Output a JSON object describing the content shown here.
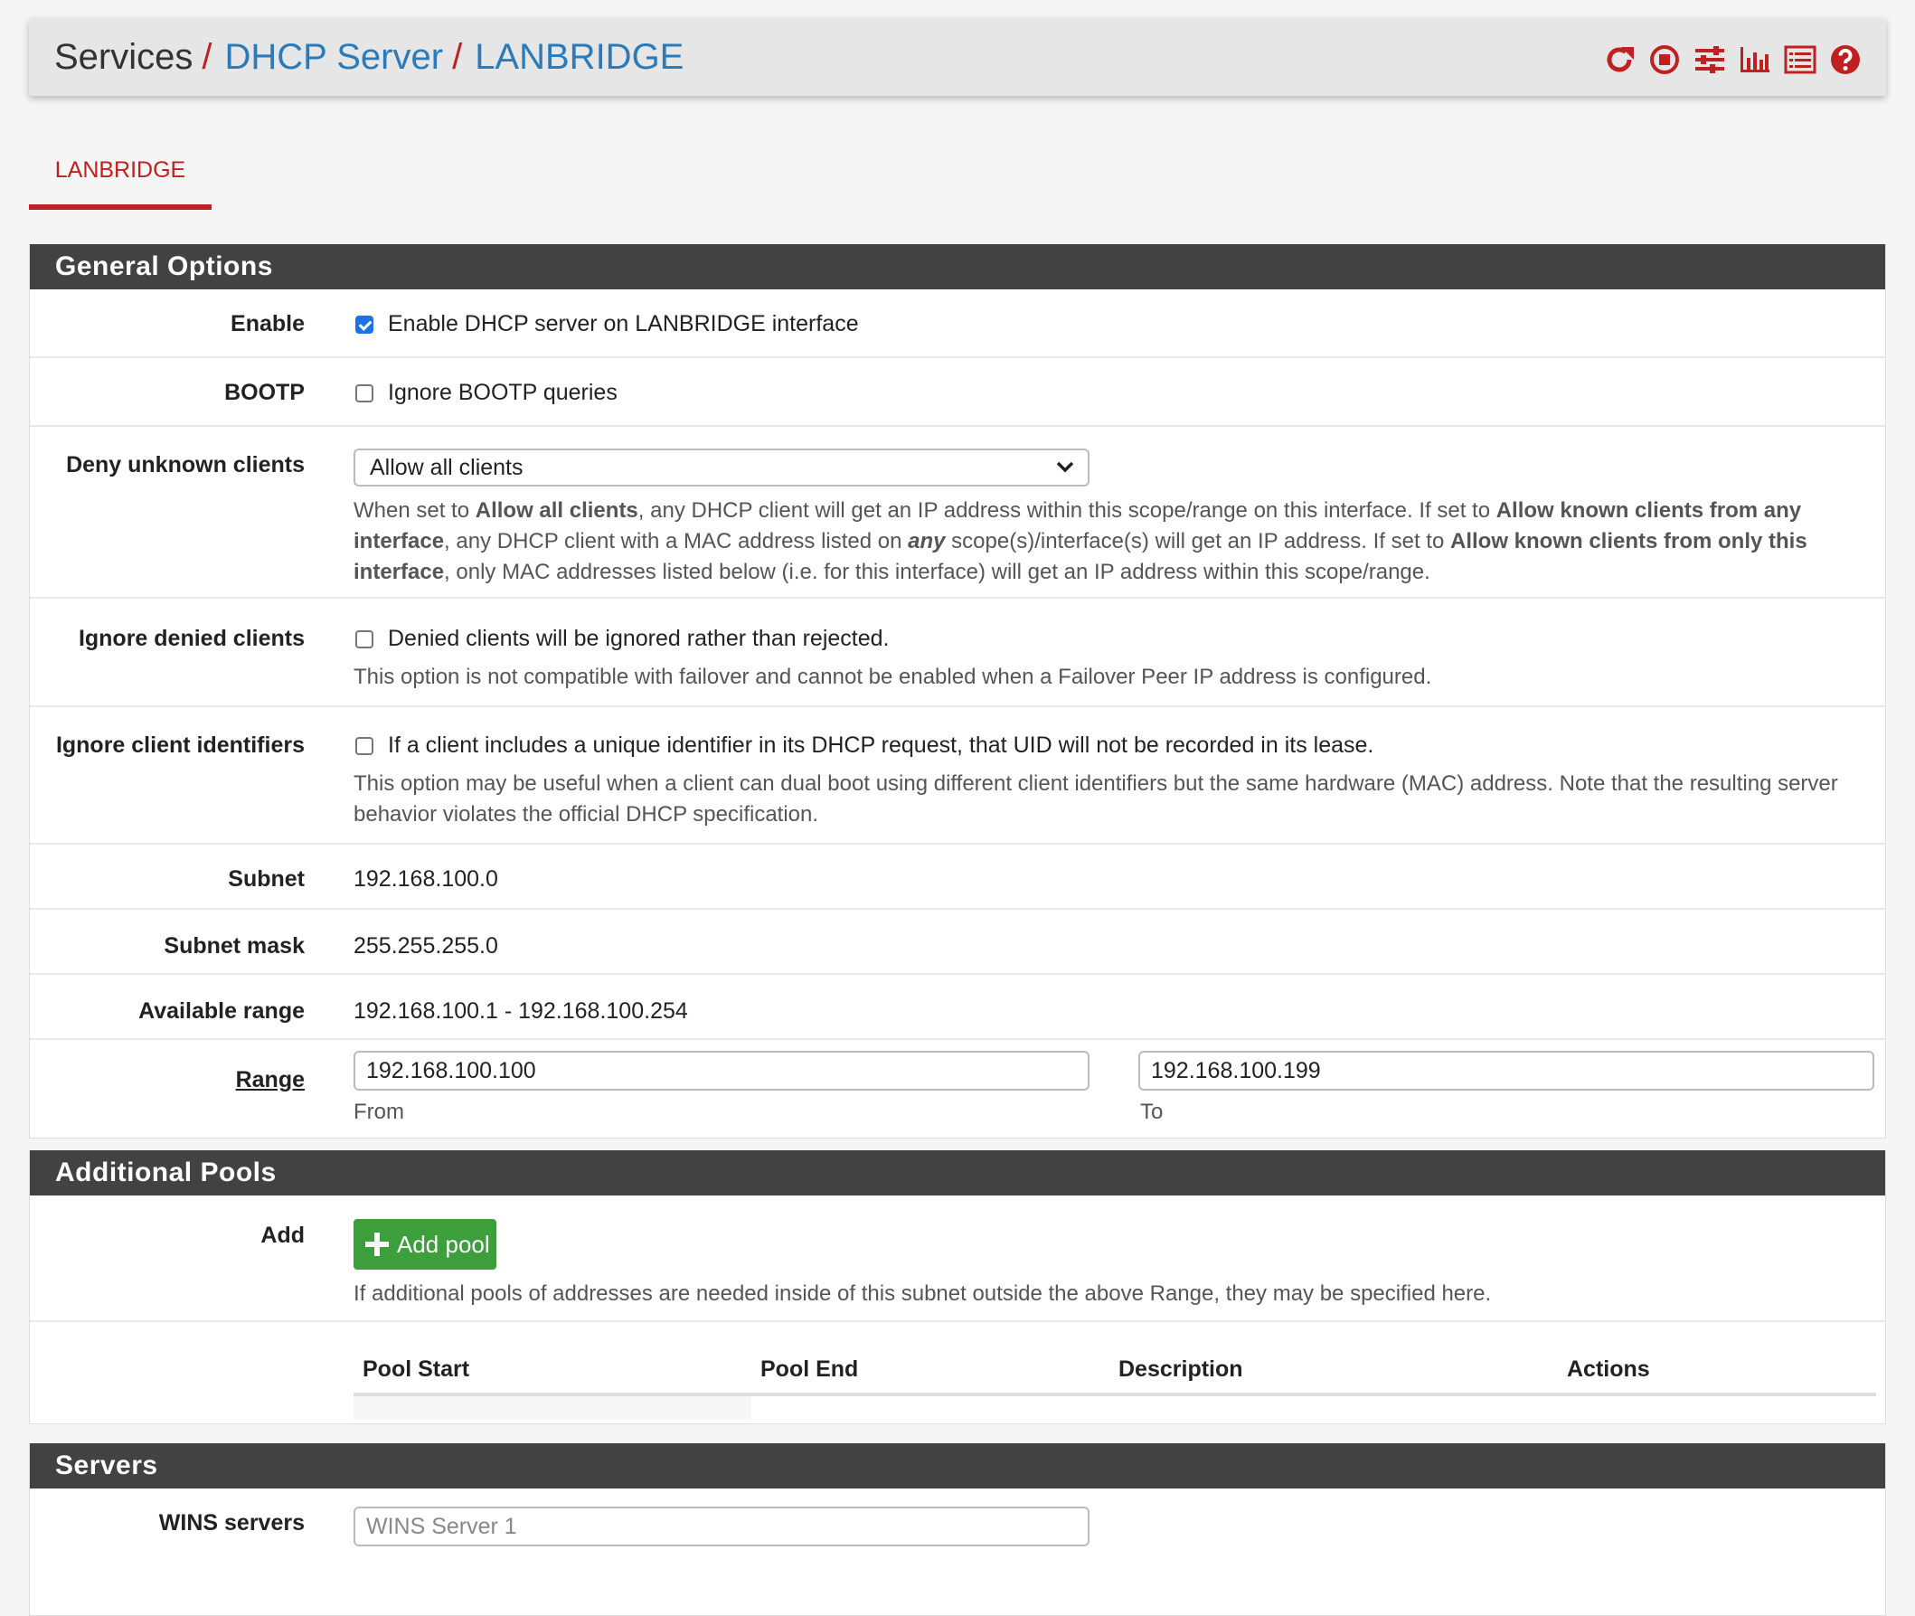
{
  "header": {
    "crumb1": "Services",
    "crumb2": "DHCP Server",
    "crumb3": "LANBRIDGE",
    "separator": "/",
    "icons": [
      "restart-icon",
      "stop-icon",
      "sliders-icon",
      "bar-chart-icon",
      "log-list-icon",
      "help-icon"
    ],
    "accent_color": "#c12020",
    "link_color": "#2b7bba"
  },
  "tabs": [
    {
      "label": "LANBRIDGE",
      "active": true
    }
  ],
  "general": {
    "heading": "General Options",
    "enable": {
      "label": "Enable",
      "text": "Enable DHCP server on LANBRIDGE interface",
      "checked": true
    },
    "bootp": {
      "label": "BOOTP",
      "text": "Ignore BOOTP queries",
      "checked": false
    },
    "deny": {
      "label": "Deny unknown clients",
      "selected": "Allow all clients",
      "h1": "When set to ",
      "h2": "Allow all clients",
      "h3": ", any DHCP client will get an IP address within this scope/range on this interface. If set to ",
      "h4": "Allow known clients from any interface",
      "h5": ", any DHCP client with a MAC address listed on ",
      "h6": "any",
      "h7": " scope(s)/interface(s) will get an IP address. If set to ",
      "h8": "Allow known clients from only this interface",
      "h9": ", only MAC addresses listed below (i.e. for this interface) will get an IP address within this scope/range."
    },
    "ignore_denied": {
      "label": "Ignore denied clients",
      "text": "Denied clients will be ignored rather than rejected.",
      "help": "This option is not compatible with failover and cannot be enabled when a Failover Peer IP address is configured.",
      "checked": false
    },
    "ignore_cid": {
      "label": "Ignore client identifiers",
      "text": "If a client includes a unique identifier in its DHCP request, that UID will not be recorded in its lease.",
      "help": "This option may be useful when a client can dual boot using different client identifiers but the same hardware (MAC) address. Note that the resulting server behavior violates the official DHCP specification.",
      "checked": false
    },
    "subnet": {
      "label": "Subnet",
      "value": "192.168.100.0"
    },
    "mask": {
      "label": "Subnet mask",
      "value": "255.255.255.0"
    },
    "available": {
      "label": "Available range",
      "value": "192.168.100.1 - 192.168.100.254"
    },
    "range": {
      "label": "Range",
      "from": "192.168.100.100",
      "to": "192.168.100.199",
      "from_label": "From",
      "to_label": "To"
    }
  },
  "pools": {
    "heading": "Additional Pools",
    "add_label": "Add",
    "button": "Add pool",
    "help": "If additional pools of addresses are needed inside of this subnet outside the above Range, they may be specified here.",
    "columns": [
      "Pool Start",
      "Pool End",
      "Description",
      "Actions"
    ],
    "button_color": "#3c9f3c"
  },
  "servers": {
    "heading": "Servers",
    "wins_label": "WINS servers",
    "wins_placeholder": "WINS Server 1"
  }
}
